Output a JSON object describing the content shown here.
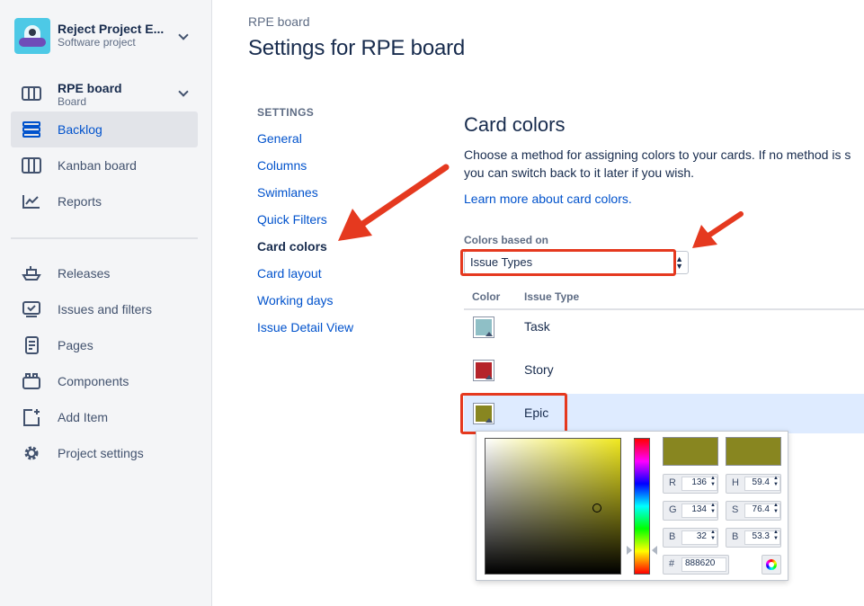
{
  "project": {
    "name": "Reject Project E...",
    "type": "Software project"
  },
  "board": {
    "name": "RPE board",
    "type": "Board"
  },
  "sidebar": {
    "items": [
      {
        "label": "Backlog",
        "icon": "backlog-icon",
        "active": true
      },
      {
        "label": "Kanban board",
        "icon": "kanban-icon"
      },
      {
        "label": "Reports",
        "icon": "reports-icon"
      },
      {
        "label": "Releases",
        "icon": "releases-icon"
      },
      {
        "label": "Issues and filters",
        "icon": "issues-icon"
      },
      {
        "label": "Pages",
        "icon": "pages-icon"
      },
      {
        "label": "Components",
        "icon": "components-icon"
      },
      {
        "label": "Add Item",
        "icon": "add-item-icon"
      },
      {
        "label": "Project settings",
        "icon": "gear-icon"
      }
    ]
  },
  "header": {
    "breadcrumb": "RPE board",
    "title": "Settings for RPE board"
  },
  "settings_nav": {
    "heading": "SETTINGS",
    "items": [
      "General",
      "Columns",
      "Swimlanes",
      "Quick Filters",
      "Card colors",
      "Card layout",
      "Working days",
      "Issue Detail View"
    ],
    "active": "Card colors"
  },
  "card_colors": {
    "title": "Card colors",
    "desc_line1": "Choose a method for assigning colors to your cards. If no method is s",
    "desc_line2": "you can switch back to it later if you wish.",
    "learn_more": "Learn more about card colors.",
    "based_on_label": "Colors based on",
    "based_on_value": "Issue Types",
    "table": {
      "headers": [
        "Color",
        "Issue Type"
      ],
      "rows": [
        {
          "type": "Task",
          "color": "#8fbfc6"
        },
        {
          "type": "Story",
          "color": "#b5242a"
        },
        {
          "type": "Epic",
          "color": "#888620"
        }
      ]
    }
  },
  "color_picker": {
    "current_color": "#888620",
    "R": "136",
    "G": "134",
    "B": "32",
    "H": "59.4",
    "S": "76.4",
    "Bv": "53.3",
    "hex_label": "#",
    "hex": "888620"
  },
  "accents": {
    "annotation_red": "#e5391f",
    "link_blue": "#0052cc",
    "active_bg": "#e2e4e9"
  }
}
